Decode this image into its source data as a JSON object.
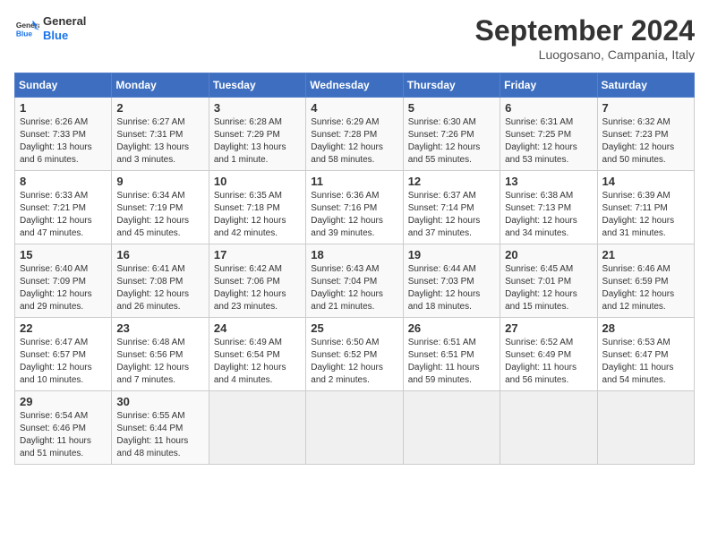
{
  "header": {
    "logo_general": "General",
    "logo_blue": "Blue",
    "month_year": "September 2024",
    "location": "Luogosano, Campania, Italy"
  },
  "weekdays": [
    "Sunday",
    "Monday",
    "Tuesday",
    "Wednesday",
    "Thursday",
    "Friday",
    "Saturday"
  ],
  "weeks": [
    [
      {
        "day": "1",
        "sunrise": "6:26 AM",
        "sunset": "7:33 PM",
        "daylight": "13 hours and 6 minutes."
      },
      {
        "day": "2",
        "sunrise": "6:27 AM",
        "sunset": "7:31 PM",
        "daylight": "13 hours and 3 minutes."
      },
      {
        "day": "3",
        "sunrise": "6:28 AM",
        "sunset": "7:29 PM",
        "daylight": "13 hours and 1 minute."
      },
      {
        "day": "4",
        "sunrise": "6:29 AM",
        "sunset": "7:28 PM",
        "daylight": "12 hours and 58 minutes."
      },
      {
        "day": "5",
        "sunrise": "6:30 AM",
        "sunset": "7:26 PM",
        "daylight": "12 hours and 55 minutes."
      },
      {
        "day": "6",
        "sunrise": "6:31 AM",
        "sunset": "7:25 PM",
        "daylight": "12 hours and 53 minutes."
      },
      {
        "day": "7",
        "sunrise": "6:32 AM",
        "sunset": "7:23 PM",
        "daylight": "12 hours and 50 minutes."
      }
    ],
    [
      {
        "day": "8",
        "sunrise": "6:33 AM",
        "sunset": "7:21 PM",
        "daylight": "12 hours and 47 minutes."
      },
      {
        "day": "9",
        "sunrise": "6:34 AM",
        "sunset": "7:19 PM",
        "daylight": "12 hours and 45 minutes."
      },
      {
        "day": "10",
        "sunrise": "6:35 AM",
        "sunset": "7:18 PM",
        "daylight": "12 hours and 42 minutes."
      },
      {
        "day": "11",
        "sunrise": "6:36 AM",
        "sunset": "7:16 PM",
        "daylight": "12 hours and 39 minutes."
      },
      {
        "day": "12",
        "sunrise": "6:37 AM",
        "sunset": "7:14 PM",
        "daylight": "12 hours and 37 minutes."
      },
      {
        "day": "13",
        "sunrise": "6:38 AM",
        "sunset": "7:13 PM",
        "daylight": "12 hours and 34 minutes."
      },
      {
        "day": "14",
        "sunrise": "6:39 AM",
        "sunset": "7:11 PM",
        "daylight": "12 hours and 31 minutes."
      }
    ],
    [
      {
        "day": "15",
        "sunrise": "6:40 AM",
        "sunset": "7:09 PM",
        "daylight": "12 hours and 29 minutes."
      },
      {
        "day": "16",
        "sunrise": "6:41 AM",
        "sunset": "7:08 PM",
        "daylight": "12 hours and 26 minutes."
      },
      {
        "day": "17",
        "sunrise": "6:42 AM",
        "sunset": "7:06 PM",
        "daylight": "12 hours and 23 minutes."
      },
      {
        "day": "18",
        "sunrise": "6:43 AM",
        "sunset": "7:04 PM",
        "daylight": "12 hours and 21 minutes."
      },
      {
        "day": "19",
        "sunrise": "6:44 AM",
        "sunset": "7:03 PM",
        "daylight": "12 hours and 18 minutes."
      },
      {
        "day": "20",
        "sunrise": "6:45 AM",
        "sunset": "7:01 PM",
        "daylight": "12 hours and 15 minutes."
      },
      {
        "day": "21",
        "sunrise": "6:46 AM",
        "sunset": "6:59 PM",
        "daylight": "12 hours and 12 minutes."
      }
    ],
    [
      {
        "day": "22",
        "sunrise": "6:47 AM",
        "sunset": "6:57 PM",
        "daylight": "12 hours and 10 minutes."
      },
      {
        "day": "23",
        "sunrise": "6:48 AM",
        "sunset": "6:56 PM",
        "daylight": "12 hours and 7 minutes."
      },
      {
        "day": "24",
        "sunrise": "6:49 AM",
        "sunset": "6:54 PM",
        "daylight": "12 hours and 4 minutes."
      },
      {
        "day": "25",
        "sunrise": "6:50 AM",
        "sunset": "6:52 PM",
        "daylight": "12 hours and 2 minutes."
      },
      {
        "day": "26",
        "sunrise": "6:51 AM",
        "sunset": "6:51 PM",
        "daylight": "11 hours and 59 minutes."
      },
      {
        "day": "27",
        "sunrise": "6:52 AM",
        "sunset": "6:49 PM",
        "daylight": "11 hours and 56 minutes."
      },
      {
        "day": "28",
        "sunrise": "6:53 AM",
        "sunset": "6:47 PM",
        "daylight": "11 hours and 54 minutes."
      }
    ],
    [
      {
        "day": "29",
        "sunrise": "6:54 AM",
        "sunset": "6:46 PM",
        "daylight": "11 hours and 51 minutes."
      },
      {
        "day": "30",
        "sunrise": "6:55 AM",
        "sunset": "6:44 PM",
        "daylight": "11 hours and 48 minutes."
      },
      null,
      null,
      null,
      null,
      null
    ]
  ]
}
